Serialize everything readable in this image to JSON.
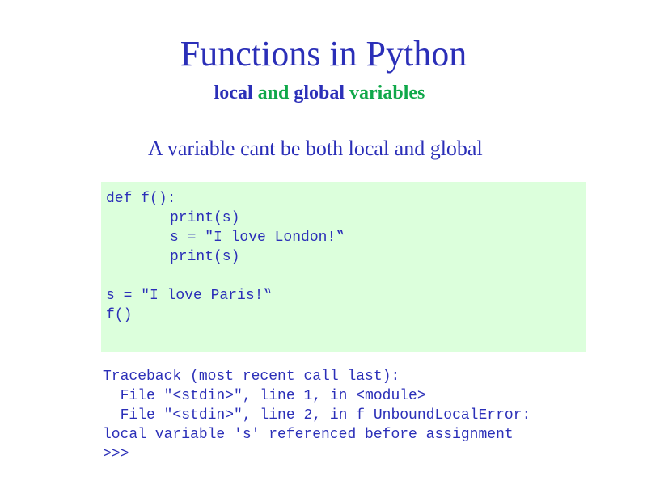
{
  "slide": {
    "title": "Functions in Python",
    "subtitle": {
      "part1": "local",
      "part2": " and ",
      "part3": "global",
      "part4": " variables"
    },
    "statement": "A variable cant be both local and global"
  },
  "code": {
    "lines": [
      "def f():",
      "print(s)",
      "s = \"I love London!‟",
      "print(s)",
      "",
      "s = \"I love Paris!‟",
      "f()"
    ]
  },
  "output": {
    "lines": [
      "Traceback (most recent call last):",
      "  File \"<stdin>\", line 1, in <module>",
      "  File \"<stdin>\", line 2, in f UnboundLocalError:",
      "local variable 's' referenced before assignment",
      ">>>"
    ]
  },
  "colors": {
    "text_blue": "#2b2fb8",
    "accent_green": "#10a84a",
    "code_background": "#dcffdc"
  }
}
